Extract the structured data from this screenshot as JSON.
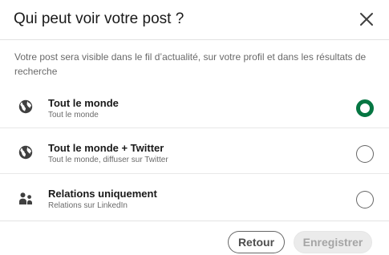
{
  "dialog": {
    "title": "Qui peut voir votre post ?",
    "close_icon": "close-icon",
    "description": "Votre post sera visible dans le fil d’actualité, sur votre profil et dans les résultats de recherche"
  },
  "options": [
    {
      "label": "Tout le monde",
      "sublabel": "Tout le monde",
      "icon": "globe-icon",
      "selected": true
    },
    {
      "label": "Tout le monde + Twitter",
      "sublabel": "Tout le monde, diffuser sur Twitter",
      "icon": "globe-icon",
      "selected": false
    },
    {
      "label": "Relations uniquement",
      "sublabel": "Relations sur LinkedIn",
      "icon": "people-icon",
      "selected": false
    }
  ],
  "footer": {
    "back_label": "Retour",
    "save_label": "Enregistrer",
    "save_enabled": false
  },
  "colors": {
    "selected_radio": "#057642",
    "text_primary": "rgba(0,0,0,0.9)",
    "text_secondary": "rgba(0,0,0,0.6)"
  }
}
